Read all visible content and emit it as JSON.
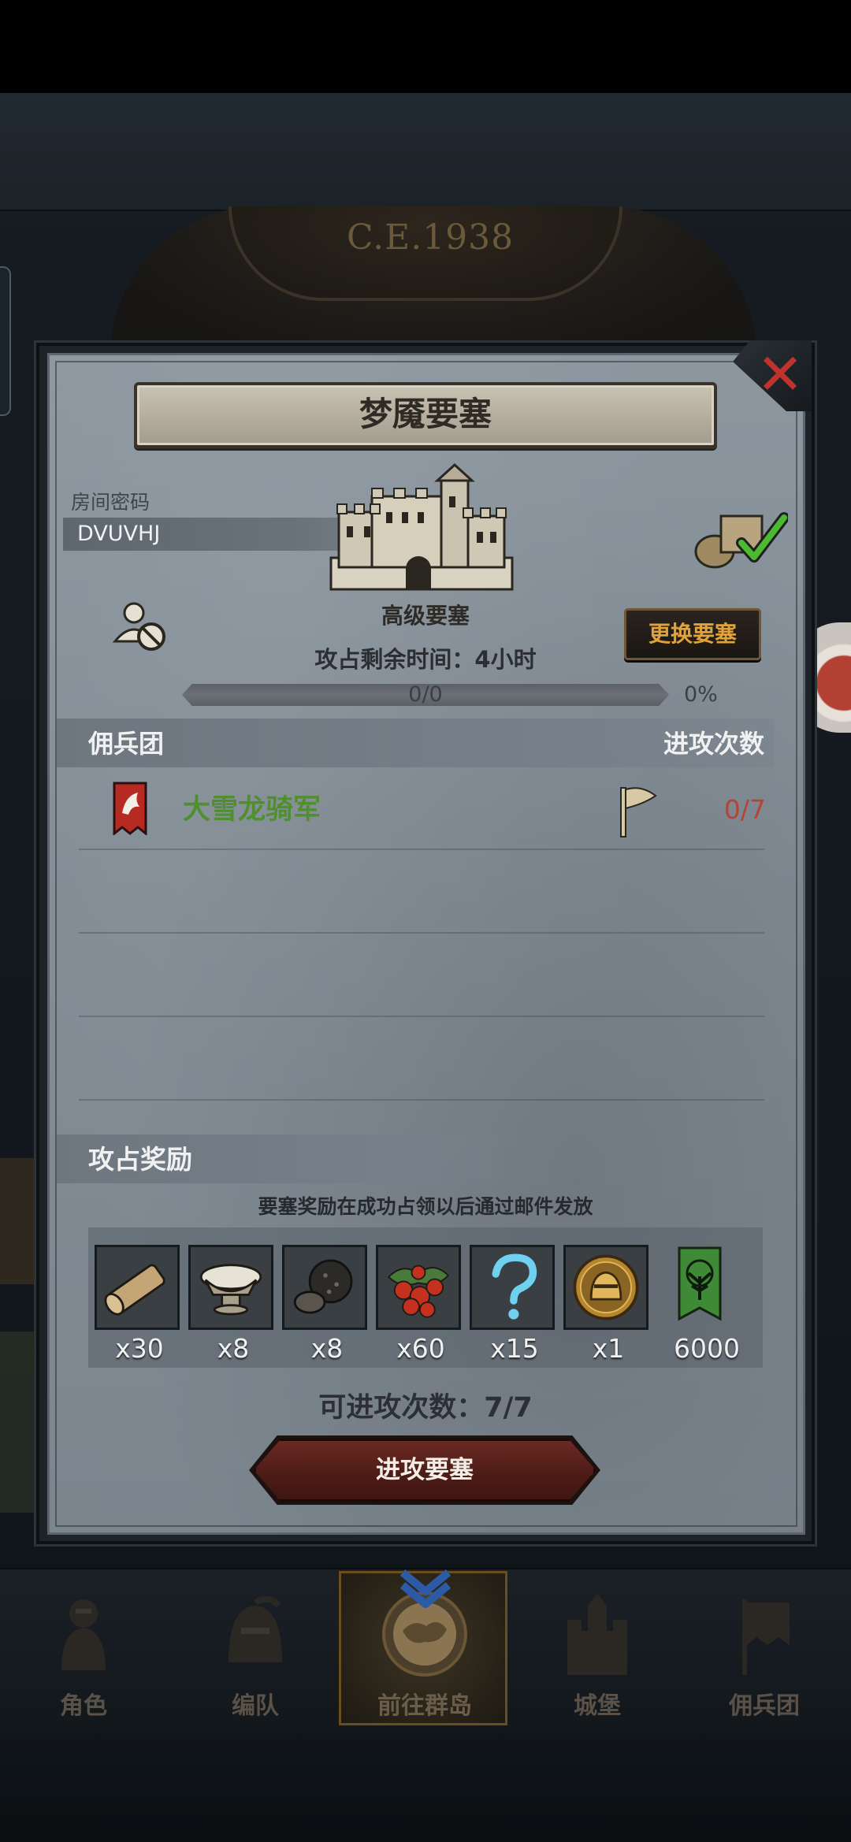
{
  "header": {
    "year_label": "C.E.1938"
  },
  "dialog": {
    "title": "梦魇要塞",
    "room": {
      "label": "房间密码",
      "code": "DVUVHJ"
    },
    "fortress_type": "高级要塞",
    "change_button": "更换要塞",
    "time_remaining": "攻占剩余时间：4小时",
    "progress": {
      "text": "0/0",
      "percent_label": "0%",
      "value": 0
    },
    "list": {
      "col_name": "佣兵团",
      "col_attacks": "进攻次数",
      "rows": [
        {
          "name": "大雪龙骑军",
          "attacks": "0/7"
        }
      ]
    },
    "rewards": {
      "title": "攻占奖励",
      "note": "要塞奖励在成功占领以后通过邮件发放",
      "items": [
        {
          "icon": "wood-log-icon",
          "qty": "x30"
        },
        {
          "icon": "salt-bowl-icon",
          "qty": "x8"
        },
        {
          "icon": "truffle-icon",
          "qty": "x8"
        },
        {
          "icon": "berries-icon",
          "qty": "x60"
        },
        {
          "icon": "question-mark-icon",
          "qty": "x15"
        },
        {
          "icon": "knight-helmet-coin-icon",
          "qty": "x1"
        },
        {
          "icon": "tree-banner-icon",
          "qty": "6000"
        }
      ]
    },
    "attack_count": "可进攻次数：7/7",
    "attack_button": "进攻要塞"
  },
  "nav": {
    "tabs": [
      {
        "label": "角色",
        "icon": "knight-icon"
      },
      {
        "label": "编队",
        "icon": "helmet-icon"
      },
      {
        "label": "前往群岛",
        "icon": "island-map-icon",
        "active": true
      },
      {
        "label": "城堡",
        "icon": "castle-icon"
      },
      {
        "label": "佣兵团",
        "icon": "mercenary-banner-icon"
      }
    ]
  },
  "colors": {
    "accent_gold": "#e0a23a",
    "mercenary_green": "#4f8f2e",
    "attack_red": "#b64338",
    "close_red": "#c0322d"
  }
}
